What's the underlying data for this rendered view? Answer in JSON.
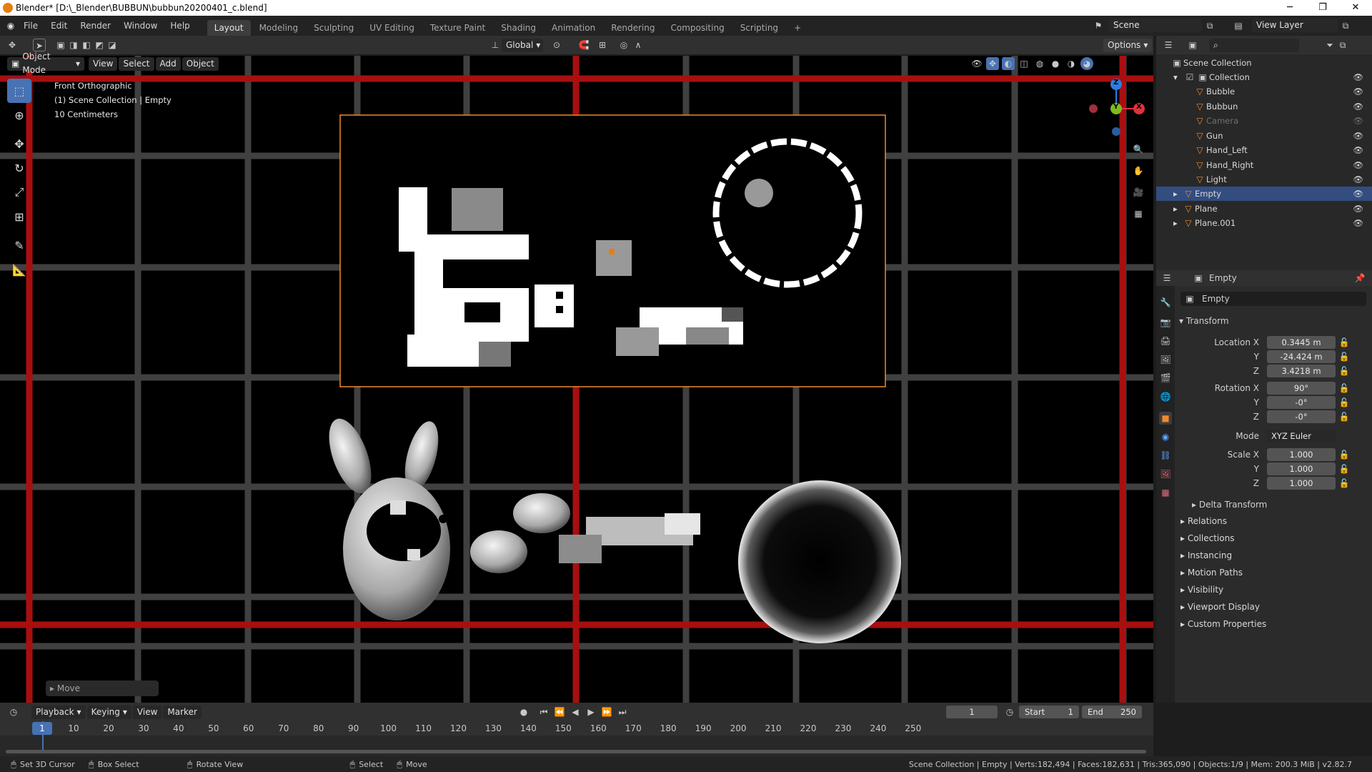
{
  "window": {
    "title": "Blender* [D:\\_Blender\\BUBBUN\\bubbun20200401_c.blend]",
    "minimize_glyph": "─",
    "restore_glyph": "❐",
    "close_glyph": "✕"
  },
  "menu": [
    "File",
    "Edit",
    "Render",
    "Window",
    "Help"
  ],
  "workspaces": [
    "Layout",
    "Modeling",
    "Sculpting",
    "UV Editing",
    "Texture Paint",
    "Shading",
    "Animation",
    "Rendering",
    "Compositing",
    "Scripting"
  ],
  "add_workspace": "+",
  "scene": {
    "name": "Scene",
    "view_layer": "View Layer"
  },
  "tool_header": {
    "orientation": "Global",
    "options": "Options"
  },
  "viewport_header": {
    "mode": "Object Mode",
    "items": [
      "View",
      "Select",
      "Add",
      "Object"
    ]
  },
  "viewport": {
    "info_lines": [
      "Front Orthographic",
      "(1) Scene Collection | Empty",
      "10 Centimeters"
    ],
    "last_operator": "Move",
    "gizmo_axes": {
      "z": "Z",
      "y": "Y",
      "x": "X"
    },
    "colors": {
      "grid_red": "#a80f0f",
      "grid_gray": "#4a4a4a",
      "selection_outline": "#f0892b"
    }
  },
  "outliner": {
    "root": "Scene Collection",
    "collection": "Collection",
    "children": [
      "Bubble",
      "Bubbun",
      "Camera",
      "Gun",
      "Hand_Left",
      "Hand_Right",
      "Light"
    ],
    "top_level": [
      "Empty",
      "Plane",
      "Plane.001"
    ],
    "selected": "Empty"
  },
  "properties": {
    "header_object": "Empty",
    "object_name": "Empty",
    "transform_label": "Transform",
    "location_labels": [
      "Location X",
      "Y",
      "Z"
    ],
    "location": [
      "0.3445 m",
      "-24.424 m",
      "3.4218 m"
    ],
    "rotation_labels": [
      "Rotation X",
      "Y",
      "Z"
    ],
    "rotation": [
      "90°",
      "-0°",
      "-0°"
    ],
    "mode_label": "Mode",
    "mode_value": "XYZ Euler",
    "scale_labels": [
      "Scale X",
      "Y",
      "Z"
    ],
    "scale": [
      "1.000",
      "1.000",
      "1.000"
    ],
    "delta_transform": "Delta Transform",
    "panels": [
      "Relations",
      "Collections",
      "Instancing",
      "Motion Paths",
      "Visibility",
      "Viewport Display",
      "Custom Properties"
    ]
  },
  "timeline": {
    "menus": [
      "Playback",
      "Keying",
      "View",
      "Marker"
    ],
    "current_frame": "1",
    "start_label": "Start",
    "start": "1",
    "end_label": "End",
    "end": "250",
    "ticks": [
      "1",
      "10",
      "20",
      "30",
      "40",
      "50",
      "60",
      "70",
      "80",
      "90",
      "100",
      "110",
      "120",
      "130",
      "140",
      "150",
      "160",
      "170",
      "180",
      "190",
      "200",
      "210",
      "220",
      "230",
      "240",
      "250"
    ]
  },
  "statusbar": {
    "hints": [
      "Set 3D Cursor",
      "Box Select",
      "Rotate View",
      "Select",
      "Move"
    ],
    "stats": "Scene Collection | Empty | Verts:182,494 | Faces:182,631 | Tris:365,090 | Objects:1/9 | Mem: 200.3 MiB | v2.82.7"
  }
}
